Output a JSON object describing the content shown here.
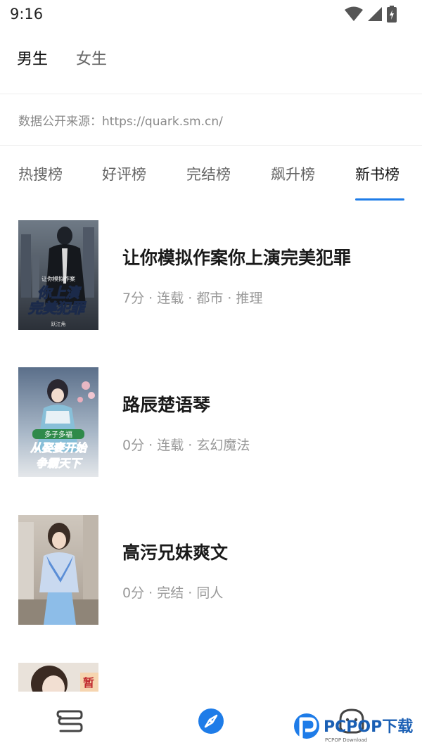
{
  "status_bar": {
    "time": "9:16"
  },
  "gender_tabs": [
    {
      "label": "男生",
      "active": true
    },
    {
      "label": "女生",
      "active": false
    }
  ],
  "source_text": "数据公开来源：https://quark.sm.cn/",
  "rank_tabs": [
    {
      "label": "热搜榜",
      "active": false
    },
    {
      "label": "好评榜",
      "active": false
    },
    {
      "label": "完结榜",
      "active": false
    },
    {
      "label": "飙升榜",
      "active": false
    },
    {
      "label": "新书榜",
      "active": true
    }
  ],
  "accent_color": "#1e7ce8",
  "books": [
    {
      "title": "让你模拟作案你上演完美犯罪",
      "meta": "7分 · 连载 · 都市 · 推理",
      "cover": {
        "series": "让你模拟作案",
        "line1": "你上演",
        "line2": "完美犯罪",
        "author": "跃江角"
      }
    },
    {
      "title": "路辰楚语琴",
      "meta": "0分 · 连载 · 玄幻魔法",
      "cover": {
        "series": "多子多福",
        "line1": "从娶妻开始",
        "line2": "争霸天下"
      }
    },
    {
      "title": "高污兄妹爽文",
      "meta": "0分 · 完结 · 同人"
    },
    {
      "title": "",
      "meta": "",
      "cover": {
        "badge": "暂"
      }
    }
  ],
  "bottom_nav": [
    {
      "icon": "bookshelf-icon"
    },
    {
      "icon": "compass-icon",
      "active": true
    },
    {
      "icon": "chat-icon"
    }
  ],
  "watermark": {
    "brand": "PCPOP下载",
    "sub": "PCPOP Download"
  }
}
